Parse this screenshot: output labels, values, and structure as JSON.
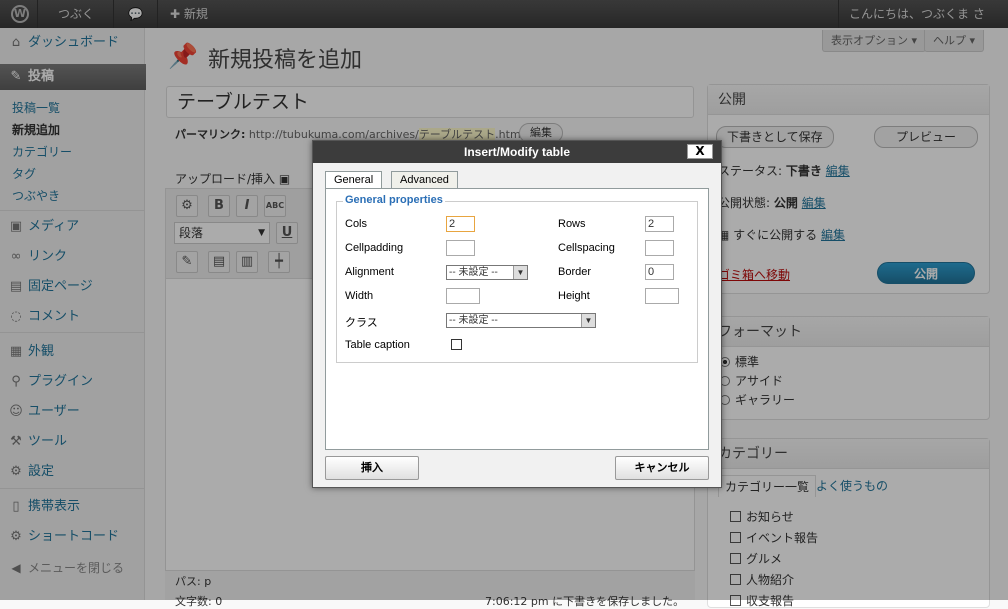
{
  "adminbar": {
    "site": "つぶくま",
    "comment": "💬",
    "new": "新規",
    "greeting": "こんにちは、つぶくま さん！"
  },
  "sidebar": {
    "items": [
      "ダッシュボード",
      "投稿",
      "メディア",
      "リンク",
      "固定ページ",
      "コメント",
      "外観",
      "プラグイン",
      "ユーザー",
      "ツール",
      "設定",
      "携帯表示",
      "ショートコード"
    ],
    "submenu": [
      "投稿一覧",
      "新規追加",
      "カテゴリー",
      "タグ",
      "つぶやき"
    ],
    "collapse": "メニューを閉じる"
  },
  "screen": {
    "options": "表示オプション ▾",
    "help": "ヘルプ ▾"
  },
  "page": {
    "title": "新規投稿を追加",
    "post_title": "テーブルテスト",
    "permalink_label": "パーマリンク:",
    "permalink_base": "http://tubukuma.com/archives/",
    "permalink_slug": "テーブルテスト",
    "permalink_ext": ".html",
    "edit": "編集",
    "upload": "アップロード/挿入"
  },
  "editor": {
    "format": "段落",
    "path": "パス: p",
    "wordcount": "文字数: 0",
    "saved": "7:06:12 pm に下書きを保存しました。"
  },
  "publish_box": {
    "title": "公開",
    "save_draft": "下書きとして保存",
    "preview": "プレビュー",
    "status_label": "ステータス:",
    "status": "下書き",
    "edit": "編集",
    "visibility_label": "公開状態:",
    "visibility": "公開",
    "schedule": "すぐに公開する",
    "trash": "ゴミ箱へ移動",
    "publish": "公開"
  },
  "format_box": {
    "title": "フォーマット",
    "options": [
      "標準",
      "アサイド",
      "ギャラリー"
    ]
  },
  "category_box": {
    "title": "カテゴリー",
    "tab_all": "カテゴリー一覧",
    "tab_popular": "よく使うもの",
    "items": [
      "お知らせ",
      "イベント報告",
      "グルメ",
      "人物紹介",
      "収支報告"
    ]
  },
  "dialog": {
    "title": "Insert/Modify table",
    "close": "X",
    "tabs": [
      "General",
      "Advanced"
    ],
    "legend": "General properties",
    "cols_label": "Cols",
    "cols": "2",
    "rows_label": "Rows",
    "rows": "2",
    "cellpadding_label": "Cellpadding",
    "cellpadding": "",
    "cellspacing_label": "Cellspacing",
    "cellspacing": "",
    "alignment_label": "Alignment",
    "alignment": "-- 未設定 --",
    "border_label": "Border",
    "border": "0",
    "width_label": "Width",
    "width": "",
    "height_label": "Height",
    "height": "",
    "class_label": "クラス",
    "class": "-- 未設定 --",
    "caption_label": "Table caption",
    "insert": "挿入",
    "cancel": "キャンセル"
  }
}
